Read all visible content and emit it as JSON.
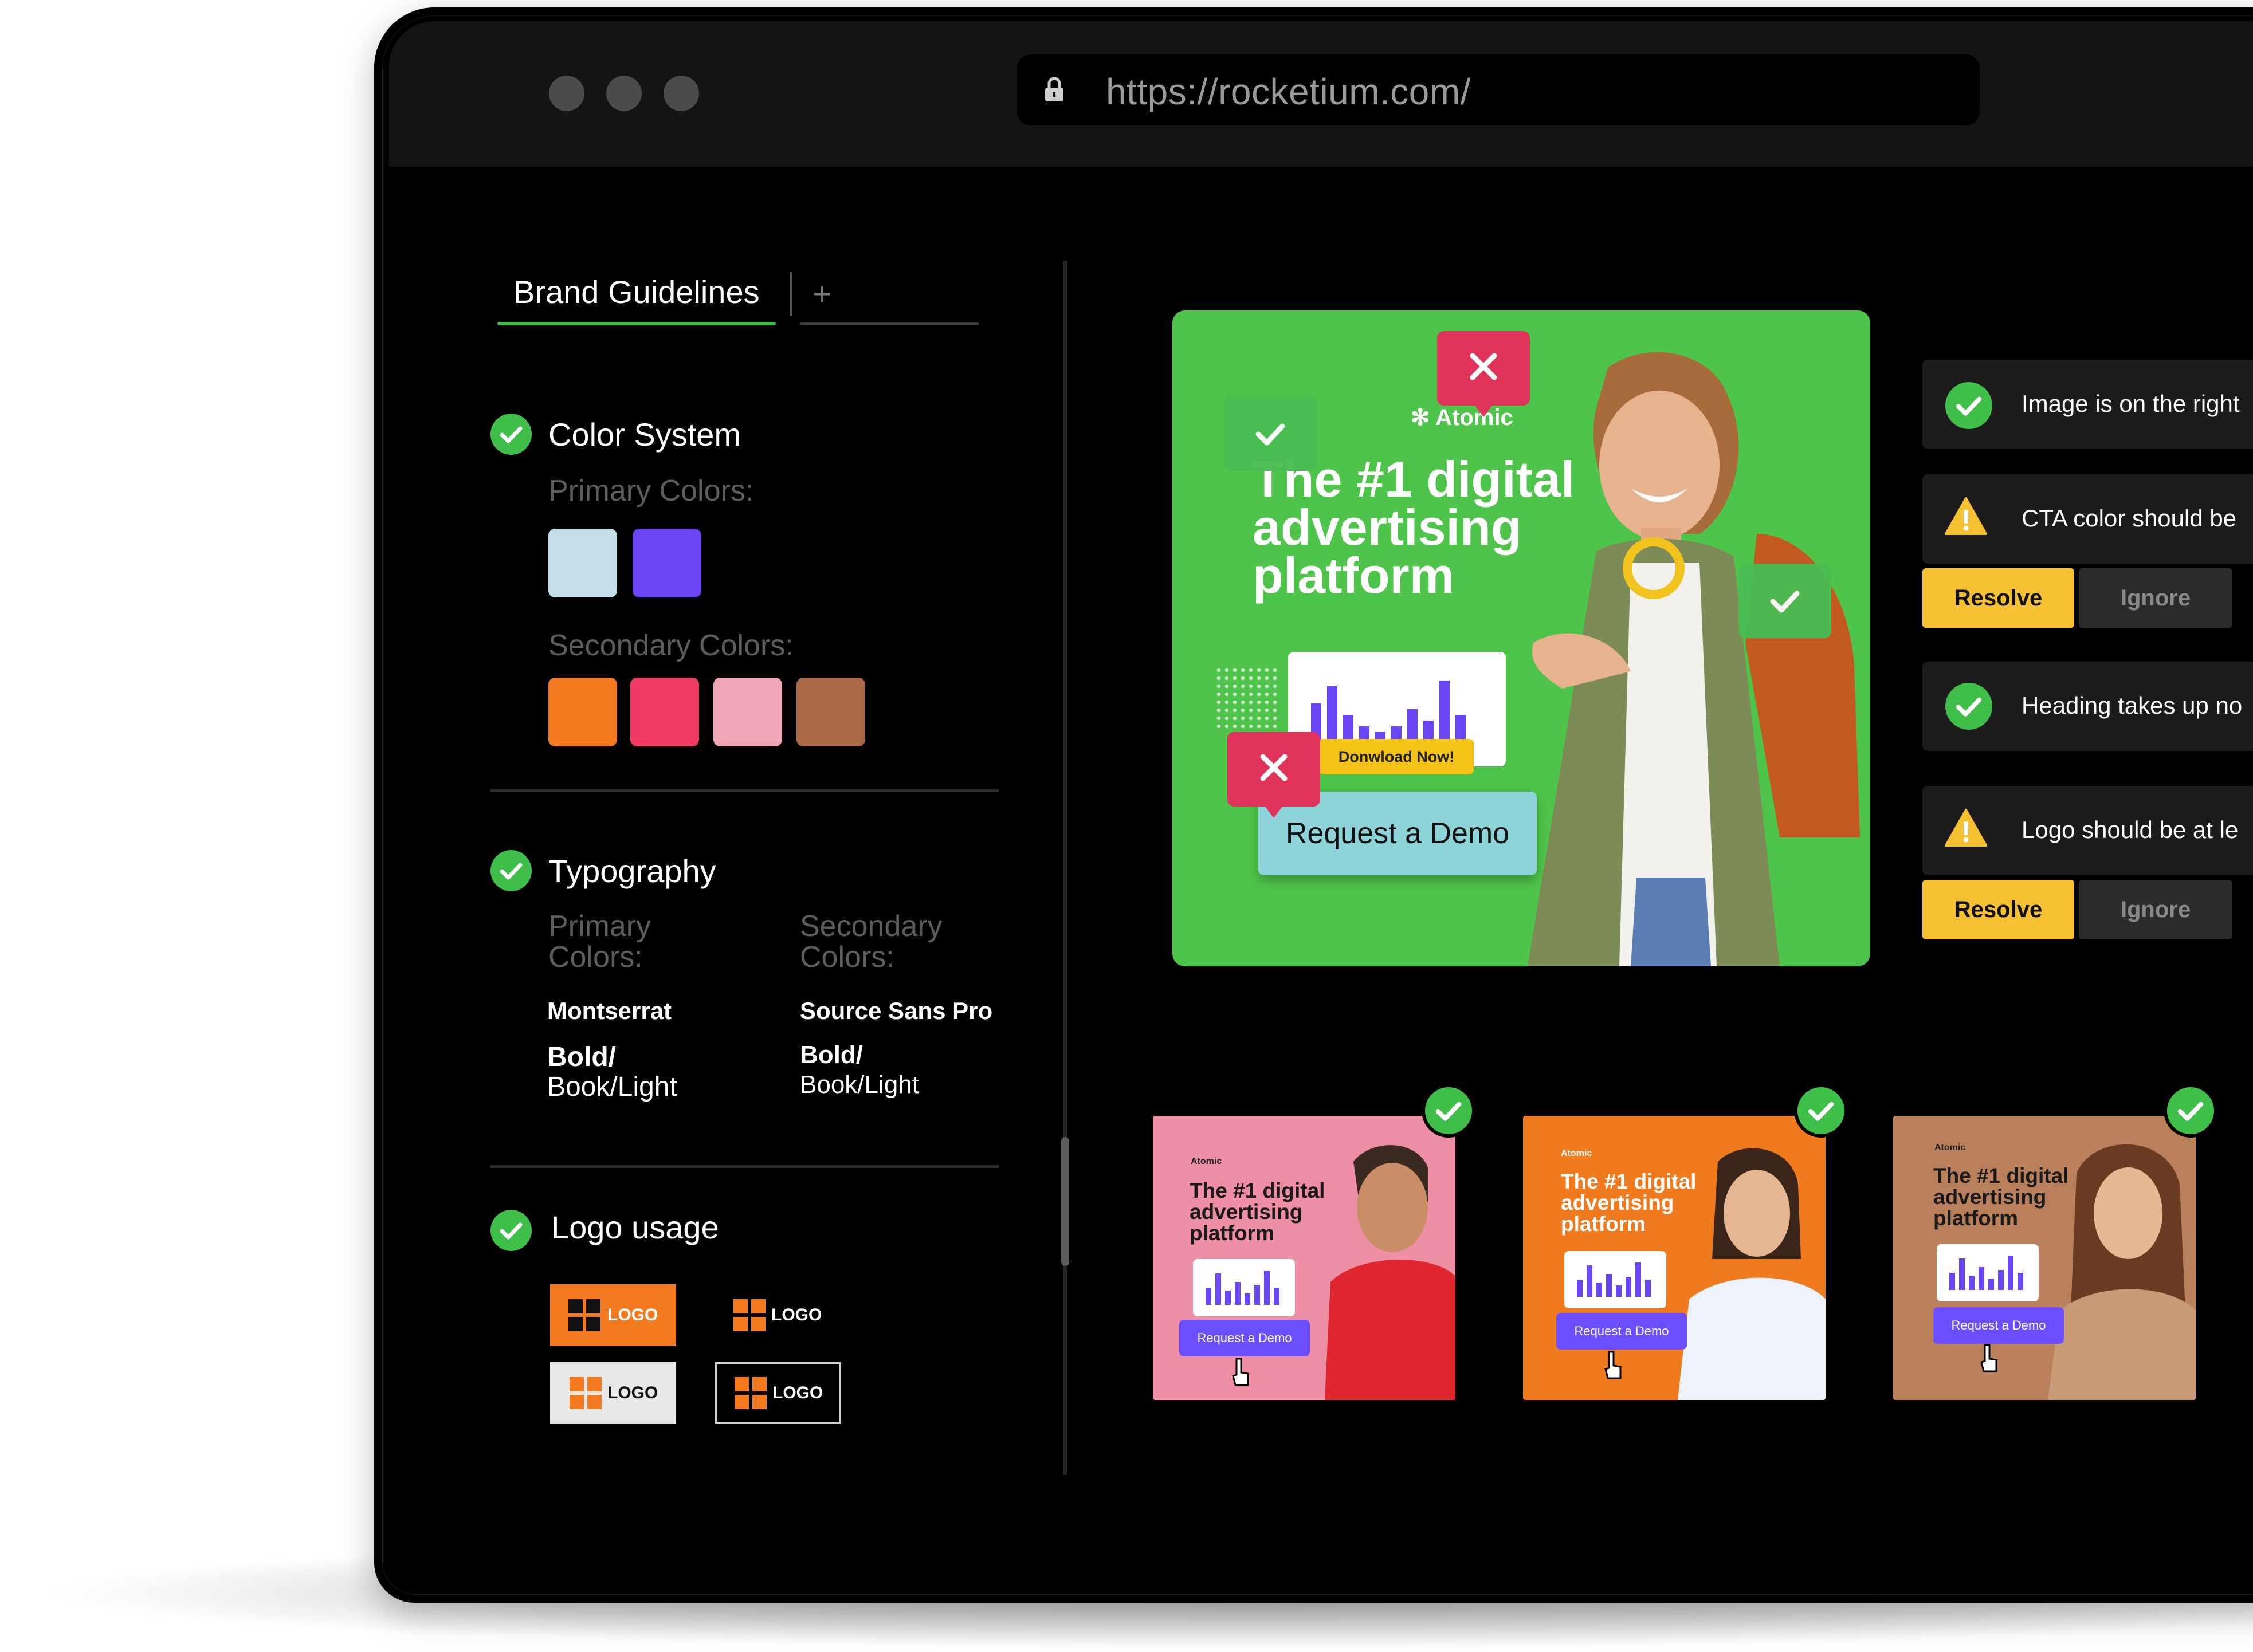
{
  "browser": {
    "url": "https://rocketium.com/"
  },
  "sidebar": {
    "tab_label": "Brand Guidelines",
    "tab_add": "+",
    "color_system": {
      "title": "Color System",
      "primary_label": "Primary Colors:",
      "primary_colors": [
        "#c3dfe9",
        "#6b46f5"
      ],
      "secondary_label": "Secondary Colors:",
      "secondary_colors": [
        "#f47a1f",
        "#ef3b64",
        "#f1a6b6",
        "#a96a45"
      ]
    },
    "typography": {
      "title": "Typography",
      "primary_label": "Primary Colors:",
      "secondary_label": "Secondary Colors:",
      "primary_font": "Montserrat",
      "secondary_font": "Source Sans Pro",
      "primary_weights_bold": "Bold/",
      "primary_weights_light": "Book/Light",
      "secondary_weights_bold": "Bold/",
      "secondary_weights_light": "Book/Light"
    },
    "logo_usage": {
      "title": "Logo usage",
      "logo_text": "LOGO"
    }
  },
  "banner": {
    "brand": "Atomic",
    "headline": "The #1 digital advertising platform",
    "download_label": "Donwload Now!",
    "cta_label": "Request a Demo"
  },
  "issues": [
    {
      "status": "ok",
      "text": "Image is on the right"
    },
    {
      "status": "warning",
      "text": "CTA color should be"
    },
    {
      "status": "ok",
      "text": "Heading takes up no"
    },
    {
      "status": "warning",
      "text": "Logo should be at le"
    }
  ],
  "actions": {
    "resolve": "Resolve",
    "ignore": "Ignore"
  },
  "thumbnails": [
    {
      "brand": "Atomic",
      "headline": "The #1 digital advertising platform",
      "button": "Request a Demo",
      "bg": "#ee8fa6"
    },
    {
      "brand": "Atomic",
      "headline": "The #1 digital advertising platform",
      "button": "Request a Demo",
      "bg": "#f07a1e"
    },
    {
      "brand": "Atomic",
      "headline": "The #1 digital advertising platform",
      "button": "Request a Demo",
      "bg": "#b9805b"
    }
  ],
  "colors": {
    "accent_green": "#3fbf4a",
    "warning_yellow": "#f5c032",
    "banner_green": "#4ec44a"
  }
}
